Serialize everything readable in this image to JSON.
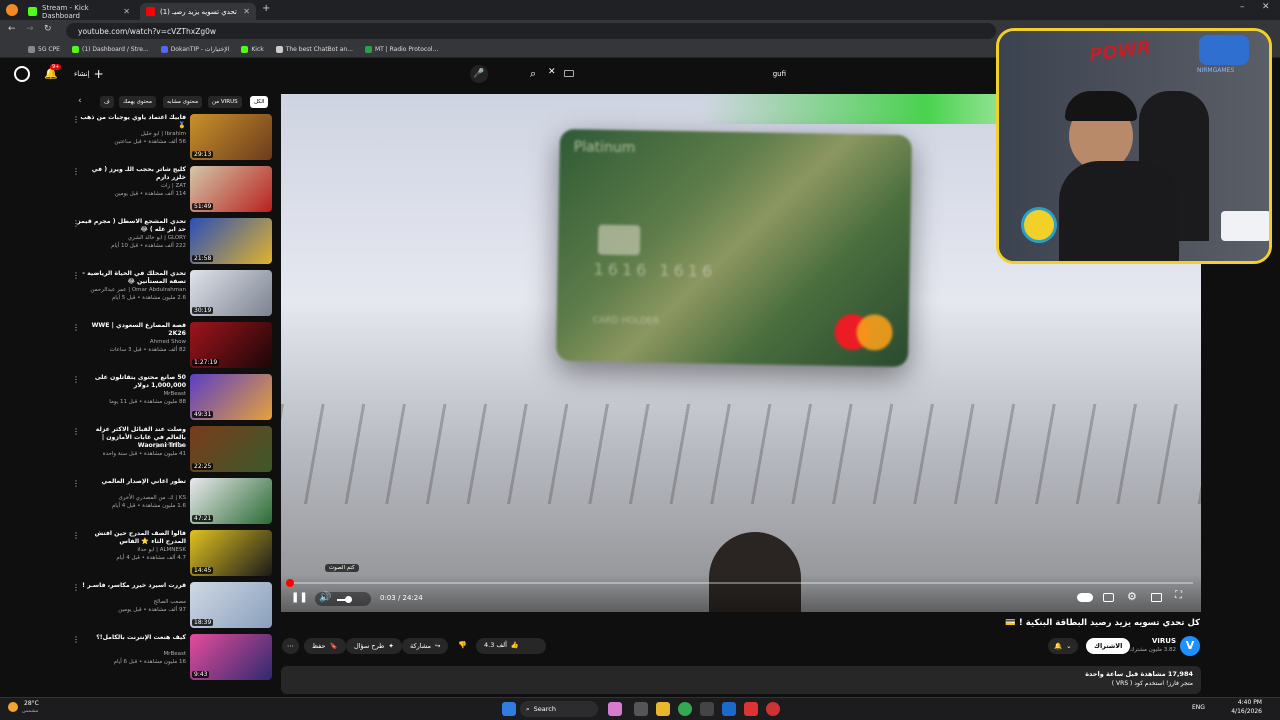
{
  "browser": {
    "tabs": [
      {
        "label": "Stream - Kick Dashboard",
        "color": "#53fc18"
      },
      {
        "label": "(1) كل تحدي تسويه يزيد رصيـ",
        "color": "#ff0000"
      }
    ],
    "url": "youtube.com/watch?v=cVZThxZg0w",
    "bookmarks": [
      "5G CPE",
      "(1) Dashboard / Stre...",
      "DokanTIP - الإختيارات",
      "Kick",
      "The best ChatBot an...",
      "MT | Radio Protocol..."
    ]
  },
  "youtube": {
    "create_label": "إنشاء",
    "notif_count": "9+",
    "search_value": "gufi",
    "chips": [
      "الكل",
      "من VIRUS",
      "محتوى مشابه",
      "محتوى يهمك",
      "ف"
    ],
    "sidebar": [
      {
        "title": "فابيك اعتماد ياوي يوجبات من ذهب 🥇",
        "channel": "Ibrahim | ابو خليل",
        "meta": "56 ألف مشاهدة • قبل ساعتين",
        "dur": "29:13",
        "c1": "#c9902a",
        "c2": "#6b3b1d"
      },
      {
        "title": "كليج شاتر بحجب اللـ ويرز ( في خلزر دارم",
        "channel": "ZAT | زات",
        "meta": "114 ألف مشاهدة • قبل يومين",
        "dur": "51:49",
        "c1": "#d3c7a9",
        "c2": "#b8211e"
      },
      {
        "title": "تحدي المشجع الاسطل ( مجرم قيمز حد ابر عله ) 😂",
        "channel": "GLORY | ابو خالد الشري",
        "meta": "222 ألف مشاهدة • قبل 10 أيام",
        "dur": "21:58",
        "c1": "#2a4fb8",
        "c2": "#e0b32c"
      },
      {
        "title": "تحدي المحلك في الحياة الرياضية - تصفة المستأنين 😂",
        "channel": "Omar Abdulrahman | عمر عبدالرحمن",
        "meta": "2.6 مليون مشاهدة • قبل 5 أيام",
        "dur": "30:19",
        "c1": "#dfe3ea",
        "c2": "#7b8290"
      },
      {
        "title": "قصة المصارع السعودي | WWE 2K26",
        "channel": "Ahmed Show",
        "meta": "82 ألف مشاهدة • قبل 3 ساعات",
        "dur": "1:27:19",
        "c1": "#a0141c",
        "c2": "#1a0608"
      },
      {
        "title": "50 صانع محتوى يتقاتلون على 1,000,000 دولار",
        "channel": "MrBeast",
        "meta": "88 مليون مشاهدة • قبل 11 يوما",
        "dur": "49:31",
        "c1": "#5b3ec5",
        "c2": "#e6a13a"
      },
      {
        "title": "وصلت عند القبائل الاكثر عزلة بالعالم في غابات الأمازون | Waorani Tribe",
        "channel": "Joe HaTTab",
        "meta": "41 مليون مشاهدة • قبل سنة واحدة",
        "dur": "22:25",
        "c1": "#7a3b1c",
        "c2": "#3b5a2a"
      },
      {
        "title": "تطور اغاني الإصدار العالمي",
        "channel": "KS | ك. من المصدري الأخرى",
        "meta": "1.6 مليون مشاهدة • قبل 4 أيام",
        "dur": "47:21",
        "c1": "#e9e9ec",
        "c2": "#2b6b34"
      },
      {
        "title": "قالوا الصف المدرج حين افتش المدرج الثاء ⭐ الفاس",
        "channel": "ALMNESK | ابو حدلا",
        "meta": "4.7 ألف مشاهدة • قبل 4 أيام",
        "dur": "14:45",
        "c1": "#e0c21f",
        "c2": "#1a1a1a"
      },
      {
        "title": "قررت اسيرد خيرر مكاسر، فاسـر !",
        "channel": "مصعب الصالح",
        "meta": "97 ألف مشاهدة • قبل يومين",
        "dur": "18:39",
        "c1": "#cfd8e4",
        "c2": "#8aa0bd"
      },
      {
        "title": "كيف هنعت الإنترنت بالكامل!؟",
        "channel": "MrBeast",
        "meta": "16 مليون مشاهدة • قبل 6 أيام",
        "dur": "9:43",
        "c1": "#e64b9c",
        "c2": "#2e2a6e"
      }
    ],
    "video": {
      "time": "0:03 / 24:24",
      "progress": 0.002,
      "tooltip": "كتم الصوت",
      "title": "كل تحدي تسويه يزيد رصيد البطاقة البنكية ! 💳",
      "channel": "VIRUS",
      "subs": "3.82 مليون مشترك",
      "subscribe_label": "الاشتراك",
      "likes": "4.3 ألف",
      "share": "مشاركة",
      "ask": "طرح سؤال",
      "save": "حفظ",
      "views_line": "17,984 مشاهدة قبل ساعة واحدة",
      "desc_line": "متجر فارز! استخدم كود ( VRS )",
      "card_text": "Platinum",
      "card_holder": "CARD HOLDER",
      "card_number": "1616 1616"
    }
  },
  "webcam": {
    "brand": "POWR",
    "sign": "NIRMGAMES"
  },
  "taskbar": {
    "weather_temp": "28°C",
    "weather_desc": "مشمس",
    "search_label": "Search",
    "lang": "ENG",
    "time": "4:40 PM",
    "date": "4/16/2026"
  }
}
